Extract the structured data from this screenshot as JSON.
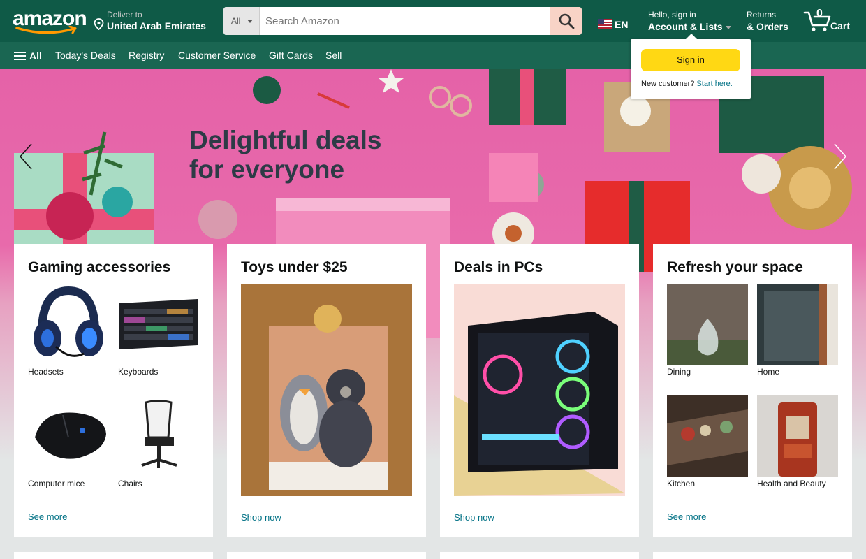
{
  "header": {
    "logo_text": "amazon",
    "deliver_to_label": "Deliver to",
    "deliver_location": "United Arab Emirates",
    "search_category": "All",
    "search_placeholder": "Search Amazon",
    "language": "EN",
    "account_greeting": "Hello, sign in",
    "account_label": "Account & Lists",
    "returns_line1": "Returns",
    "returns_line2": "& Orders",
    "cart_count": "0",
    "cart_label": "Cart"
  },
  "subnav": {
    "all_label": "All",
    "items": [
      "Today's Deals",
      "Registry",
      "Customer Service",
      "Gift Cards",
      "Sell"
    ]
  },
  "signin_flyout": {
    "button_label": "Sign in",
    "new_customer_text": "New customer?",
    "start_here_link": "Start here."
  },
  "hero": {
    "title_line1": "Delightful deals",
    "title_line2": "for everyone"
  },
  "cards": [
    {
      "title": "Gaming accessories",
      "tiles": [
        "Headsets",
        "Keyboards",
        "Computer mice",
        "Chairs"
      ],
      "link": "See more"
    },
    {
      "title": "Toys under $25",
      "link": "Shop now"
    },
    {
      "title": "Deals in PCs",
      "link": "Shop now"
    },
    {
      "title": "Refresh your space",
      "tiles": [
        "Dining",
        "Home",
        "Kitchen",
        "Health and Beauty"
      ],
      "link": "See more"
    }
  ],
  "colors": {
    "nav_bg": "#0f5a47",
    "subnav_bg": "#1a6652",
    "link": "#007185",
    "signin_button": "#ffd814",
    "search_button": "#f8d3c6"
  }
}
